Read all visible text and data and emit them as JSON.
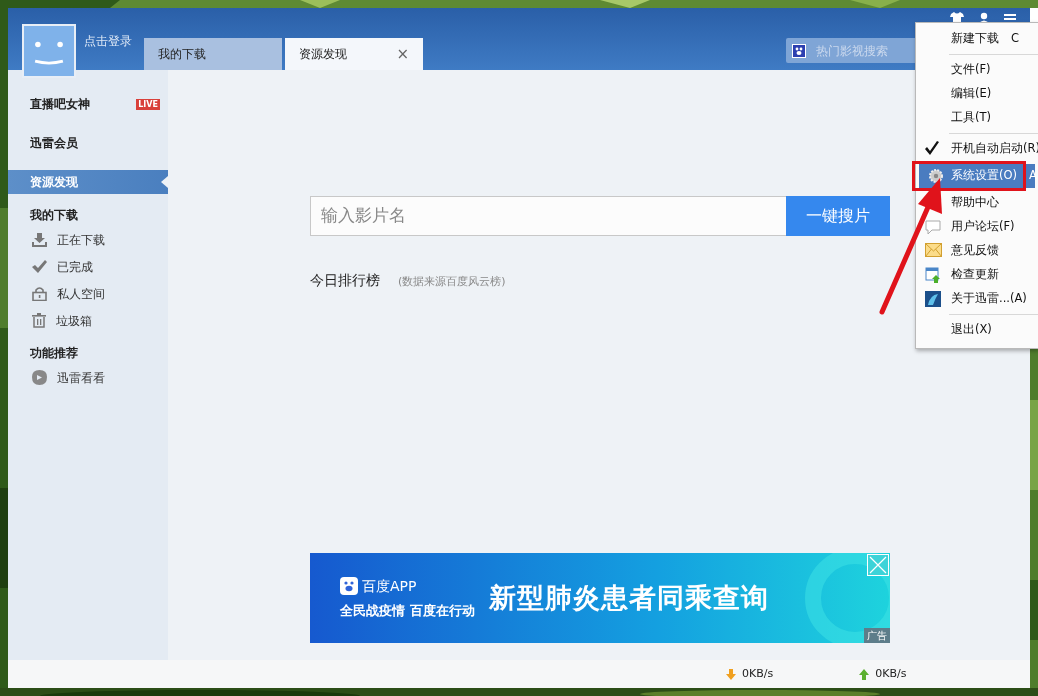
{
  "profile": {
    "login": "点击登录"
  },
  "tabs": [
    {
      "label": "我的下载",
      "selected": false,
      "closable": false
    },
    {
      "label": "资源发现",
      "selected": true,
      "closable": true,
      "close": "×"
    }
  ],
  "top_search": {
    "placeholder": "热门影视搜索"
  },
  "sidebar": {
    "items": [
      {
        "label": "直播吧女神",
        "badge": "LIVE",
        "selected": false
      },
      {
        "label": "迅雷会员",
        "selected": false
      },
      {
        "label": "资源发现",
        "selected": true
      }
    ],
    "groups": [
      {
        "label": "我的下载",
        "children": [
          {
            "label": "正在下载"
          },
          {
            "label": "已完成"
          },
          {
            "label": "私人空间"
          },
          {
            "label": "垃圾箱"
          }
        ]
      },
      {
        "label": "功能推荐",
        "children": [
          {
            "label": "迅雷看看"
          }
        ]
      }
    ]
  },
  "search": {
    "placeholder": "输入影片名",
    "button": "一键搜片"
  },
  "ranking": {
    "title": "今日排行榜",
    "note": "(数据来源百度风云榜)"
  },
  "ad": {
    "brand": "百度APP",
    "slogan": "全民战疫情 百度在行动",
    "headline": "新型肺炎患者同乘查询",
    "tag": "广告"
  },
  "status_bar": {
    "download": "0KB/s",
    "upload": "0KB/s"
  },
  "menu": [
    {
      "kind": "item",
      "label": "新建下载",
      "shortcut": "C",
      "checked": false,
      "selected": false
    },
    {
      "kind": "separator"
    },
    {
      "kind": "item",
      "label": "文件(F)",
      "checked": false,
      "selected": false
    },
    {
      "kind": "item",
      "label": "编辑(E)",
      "checked": false,
      "selected": false
    },
    {
      "kind": "item",
      "label": "工具(T)",
      "checked": false,
      "selected": false
    },
    {
      "kind": "separator"
    },
    {
      "kind": "item",
      "label": "开机自动启动(R)",
      "checked": true,
      "selected": false
    },
    {
      "kind": "item",
      "label": "系统设置(O)",
      "shortcut": "A",
      "checked": false,
      "selected": true
    },
    {
      "kind": "item",
      "label": "帮助中心",
      "selected": false
    },
    {
      "kind": "item",
      "label": "用户论坛(F)",
      "checked": false,
      "selected": false
    },
    {
      "kind": "item",
      "label": "意见反馈",
      "checked": false,
      "selected": false
    },
    {
      "kind": "item",
      "label": "检查更新",
      "checked": false,
      "selected": false
    },
    {
      "kind": "item",
      "label": "关于迅雷...(A)",
      "checked": false,
      "selected": false
    },
    {
      "kind": "separator"
    },
    {
      "kind": "item",
      "label": "退出(X)",
      "checked": false,
      "selected": false
    }
  ]
}
